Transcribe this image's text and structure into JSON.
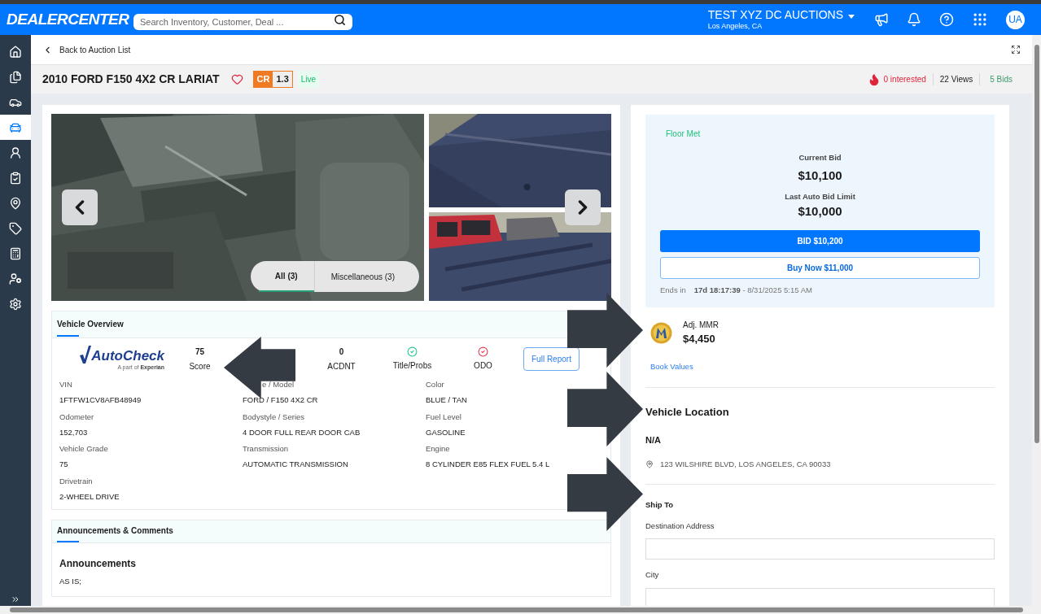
{
  "header": {
    "logo": "DEALERCENTER",
    "search": {
      "placeholder": "Search Inventory, Customer, Deal ..."
    },
    "dealer": {
      "name": "TEST XYZ DC AUCTIONS",
      "location": "Los Angeles, CA"
    },
    "avatar": "UA"
  },
  "sidebar": {
    "items": [
      {
        "selected": false
      },
      {
        "selected": false
      },
      {
        "selected": false
      },
      {
        "selected": true
      },
      {
        "selected": false
      },
      {
        "selected": false
      },
      {
        "selected": false
      },
      {
        "selected": false
      },
      {
        "selected": false
      },
      {
        "selected": false
      },
      {
        "selected": false
      }
    ]
  },
  "back_link": "Back to Auction List",
  "vehicle": {
    "title": "2010 FORD F150 4X2 CR LARIAT",
    "favorite": false,
    "cr_label": "CR",
    "cr_value": "1.3",
    "status": "Live"
  },
  "stats": {
    "interested": "0 interested",
    "views": "22 Views",
    "bids": "5 Bids"
  },
  "gallery": {
    "tabs": [
      {
        "label": "All (3)",
        "selected": true
      },
      {
        "label": "Miscellaneous (3)",
        "selected": false
      }
    ]
  },
  "overview": {
    "title": "Vehicle Overview",
    "logo": {
      "name": "AutoCheck",
      "tagline_prefix": "A part of",
      "tagline_brand": "Experian"
    },
    "stats": [
      {
        "kind": "number",
        "value": "75",
        "label": "Score"
      },
      {
        "kind": "hidden"
      },
      {
        "kind": "number",
        "value": "0",
        "label": "ACDNT"
      },
      {
        "kind": "check",
        "ok": true,
        "label": "Title/Probs"
      },
      {
        "kind": "check",
        "ok": false,
        "label": "ODO"
      }
    ],
    "report_button": "Full Report",
    "fields": [
      {
        "label": "VIN",
        "value": "1FTFW1CV8AFB48949"
      },
      {
        "label": "e / Model",
        "value": "FORD / F150 4X2 CR",
        "kind": "covered"
      },
      {
        "label": "Color",
        "value": "BLUE / TAN"
      },
      {
        "label": "Odometer",
        "value": "152,703"
      },
      {
        "label": "Bodystyle / Series",
        "value": "4 DOOR FULL REAR DOOR CAB"
      },
      {
        "label": "Fuel Level",
        "value": "GASOLINE"
      },
      {
        "label": "Vehicle Grade",
        "value": "75"
      },
      {
        "label": "Transmission",
        "value": "AUTOMATIC TRANSMISSION"
      },
      {
        "label": "Engine",
        "value": "8 CYLINDER E85 FLEX FUEL 5.4 L"
      },
      {
        "label": "Drivetrain",
        "value": "2-WHEEL DRIVE"
      }
    ]
  },
  "announcements": {
    "title": "Announcements & Comments",
    "heading": "Announcements",
    "text": "AS IS;"
  },
  "bid_panel": {
    "floor": "Floor Met",
    "current_label": "Current Bid",
    "current_value": "$10,100",
    "auto_label": "Last Auto Bid Limit",
    "auto_value": "$10,000",
    "bid_button": "BID $10,200",
    "buy_button": "Buy Now $11,000",
    "ends_label": "Ends in",
    "countdown": "17d 18:17:39",
    "end_date": "- 8/31/2025 5:15 AM"
  },
  "mmr": {
    "label": "Adj. MMR",
    "value": "$4,450"
  },
  "book_values": "Book Values",
  "location": {
    "title": "Vehicle Location",
    "name": "N/A",
    "address": "123 WILSHIRE BLVD, LOS ANGELES, CA 90033"
  },
  "ship_to": {
    "title": "Ship To",
    "fields": [
      {
        "label": "Destination Address"
      },
      {
        "label": "City"
      }
    ]
  }
}
